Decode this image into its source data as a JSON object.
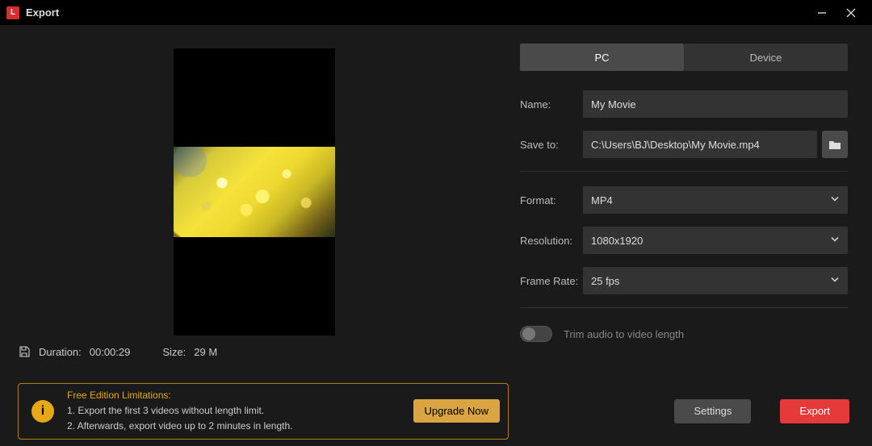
{
  "window": {
    "title": "Export"
  },
  "preview": {
    "duration_label": "Duration:",
    "duration_value": "00:00:29",
    "size_label": "Size:",
    "size_value": "29 M"
  },
  "tabs": {
    "pc": "PC",
    "device": "Device"
  },
  "form": {
    "name_label": "Name:",
    "name_value": "My Movie",
    "saveto_label": "Save to:",
    "saveto_value": "C:\\Users\\BJ\\Desktop\\My Movie.mp4",
    "format_label": "Format:",
    "format_value": "MP4",
    "resolution_label": "Resolution:",
    "resolution_value": "1080x1920",
    "framerate_label": "Frame Rate:",
    "framerate_value": "25 fps",
    "trim_label": "Trim audio to video length"
  },
  "limits": {
    "title": "Free Edition Limitations:",
    "line1": "1. Export the first 3 videos without length limit.",
    "line2": "2. Afterwards, export video up to 2 minutes in length.",
    "upgrade": "Upgrade Now"
  },
  "footer": {
    "settings": "Settings",
    "export": "Export"
  }
}
